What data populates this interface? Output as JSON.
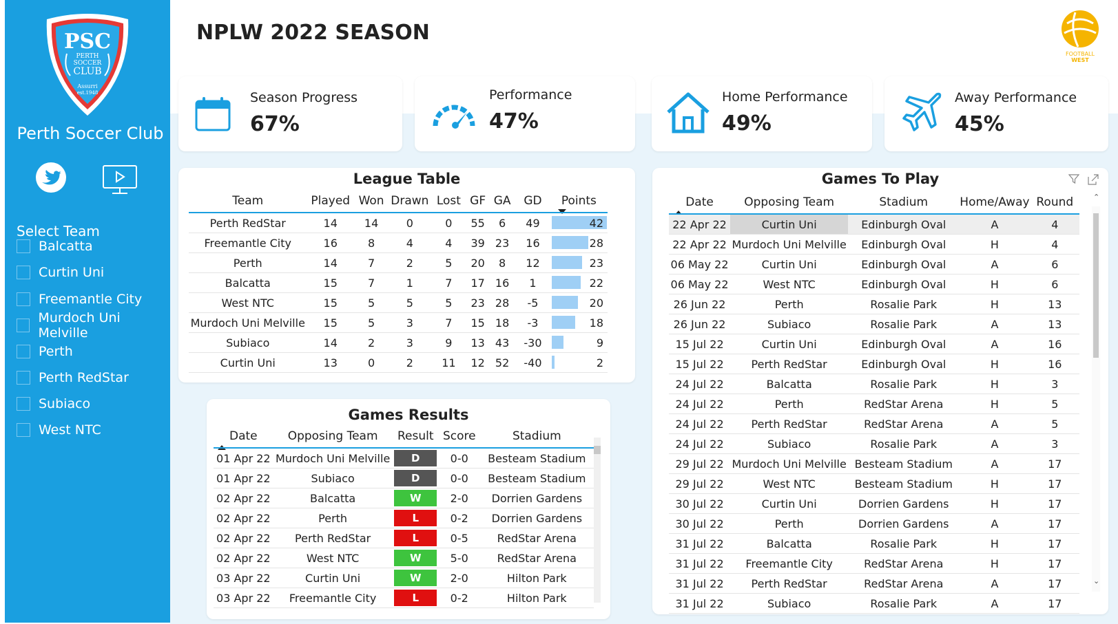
{
  "sidebar": {
    "club_name": "Perth Soccer Club",
    "logo_text": {
      "line1": "PSC",
      "line2": "PERTH",
      "line3": "SOCCER",
      "line4": "CLUB",
      "motto": "Assurri",
      "est": "est.1948"
    },
    "select_label": "Select Team",
    "teams": [
      "Balcatta",
      "Curtin Uni",
      "Freemantle City",
      "Murdoch Uni Melville",
      "Perth",
      "Perth RedStar",
      "Subiaco",
      "West NTC"
    ],
    "icons": [
      "twitter-icon",
      "video-icon"
    ]
  },
  "header": {
    "title": "NPLW 2022 SEASON",
    "partner_logo_text": {
      "line1": "FOOTBALL",
      "line2": "WEST"
    }
  },
  "kpis": [
    {
      "label": "Season Progress",
      "value": "67%",
      "icon": "calendar-icon"
    },
    {
      "label": "Performance",
      "value": "47%",
      "icon": "speedometer-icon"
    },
    {
      "label": "Home Performance",
      "value": "49%",
      "icon": "home-icon"
    },
    {
      "label": "Away Performance",
      "value": "45%",
      "icon": "airplane-icon"
    }
  ],
  "league_table": {
    "title": "League Table",
    "columns": [
      "Team",
      "Played",
      "Won",
      "Drawn",
      "Lost",
      "GF",
      "GA",
      "GD",
      "Points"
    ],
    "max_points": 42,
    "rows": [
      {
        "team": "Perth RedStar",
        "played": "14",
        "won": "14",
        "drawn": "0",
        "lost": "0",
        "gf": "55",
        "ga": "6",
        "gd": "49",
        "points": "42"
      },
      {
        "team": "Freemantle City",
        "played": "16",
        "won": "8",
        "drawn": "4",
        "lost": "4",
        "gf": "39",
        "ga": "23",
        "gd": "16",
        "points": "28"
      },
      {
        "team": "Perth",
        "played": "14",
        "won": "7",
        "drawn": "2",
        "lost": "5",
        "gf": "20",
        "ga": "8",
        "gd": "12",
        "points": "23"
      },
      {
        "team": "Balcatta",
        "played": "15",
        "won": "7",
        "drawn": "1",
        "lost": "7",
        "gf": "17",
        "ga": "16",
        "gd": "1",
        "points": "22"
      },
      {
        "team": "West NTC",
        "played": "15",
        "won": "5",
        "drawn": "5",
        "lost": "5",
        "gf": "23",
        "ga": "28",
        "gd": "-5",
        "points": "20"
      },
      {
        "team": "Murdoch Uni Melville",
        "played": "15",
        "won": "5",
        "drawn": "3",
        "lost": "7",
        "gf": "15",
        "ga": "18",
        "gd": "-3",
        "points": "18"
      },
      {
        "team": "Subiaco",
        "played": "14",
        "won": "2",
        "drawn": "3",
        "lost": "9",
        "gf": "13",
        "ga": "43",
        "gd": "-30",
        "points": "9"
      },
      {
        "team": "Curtin Uni",
        "played": "13",
        "won": "0",
        "drawn": "2",
        "lost": "11",
        "gf": "12",
        "ga": "52",
        "gd": "-40",
        "points": "2"
      }
    ]
  },
  "games_results": {
    "title": "Games Results",
    "columns": [
      "Date",
      "Opposing Team",
      "Result",
      "Score",
      "Stadium"
    ],
    "colors": {
      "D": "#555555",
      "W": "#3ec43e",
      "L": "#e01010"
    },
    "rows": [
      {
        "date": "01 Apr 22",
        "team": "Murdoch Uni Melville",
        "result": "D",
        "score": "0-0",
        "stadium": "Besteam Stadium"
      },
      {
        "date": "01 Apr 22",
        "team": "Subiaco",
        "result": "D",
        "score": "0-0",
        "stadium": "Besteam Stadium"
      },
      {
        "date": "02 Apr 22",
        "team": "Balcatta",
        "result": "W",
        "score": "2-0",
        "stadium": "Dorrien Gardens"
      },
      {
        "date": "02 Apr 22",
        "team": "Perth",
        "result": "L",
        "score": "0-2",
        "stadium": "Dorrien Gardens"
      },
      {
        "date": "02 Apr 22",
        "team": "Perth RedStar",
        "result": "L",
        "score": "0-5",
        "stadium": "RedStar Arena"
      },
      {
        "date": "02 Apr 22",
        "team": "West NTC",
        "result": "W",
        "score": "5-0",
        "stadium": "RedStar Arena"
      },
      {
        "date": "03 Apr 22",
        "team": "Curtin Uni",
        "result": "W",
        "score": "2-0",
        "stadium": "Hilton Park"
      },
      {
        "date": "03 Apr 22",
        "team": "Freemantle City",
        "result": "L",
        "score": "0-2",
        "stadium": "Hilton Park"
      }
    ]
  },
  "games_to_play": {
    "title": "Games To Play",
    "columns": [
      "Date",
      "Opposing Team",
      "Stadium",
      "Home/Away",
      "Round"
    ],
    "rows": [
      {
        "date": "22 Apr 22",
        "team": "Curtin Uni",
        "stadium": "Edinburgh Oval",
        "ha": "A",
        "round": "4"
      },
      {
        "date": "22 Apr 22",
        "team": "Murdoch Uni Melville",
        "stadium": "Edinburgh Oval",
        "ha": "H",
        "round": "4"
      },
      {
        "date": "06 May 22",
        "team": "Curtin Uni",
        "stadium": "Edinburgh Oval",
        "ha": "A",
        "round": "6"
      },
      {
        "date": "06 May 22",
        "team": "West NTC",
        "stadium": "Edinburgh Oval",
        "ha": "H",
        "round": "6"
      },
      {
        "date": "26 Jun 22",
        "team": "Perth",
        "stadium": "Rosalie Park",
        "ha": "H",
        "round": "13"
      },
      {
        "date": "26 Jun 22",
        "team": "Subiaco",
        "stadium": "Rosalie Park",
        "ha": "A",
        "round": "13"
      },
      {
        "date": "15 Jul 22",
        "team": "Curtin Uni",
        "stadium": "Edinburgh Oval",
        "ha": "A",
        "round": "16"
      },
      {
        "date": "15 Jul 22",
        "team": "Perth RedStar",
        "stadium": "Edinburgh Oval",
        "ha": "H",
        "round": "16"
      },
      {
        "date": "24 Jul 22",
        "team": "Balcatta",
        "stadium": "Rosalie Park",
        "ha": "H",
        "round": "3"
      },
      {
        "date": "24 Jul 22",
        "team": "Perth",
        "stadium": "RedStar Arena",
        "ha": "H",
        "round": "5"
      },
      {
        "date": "24 Jul 22",
        "team": "Perth RedStar",
        "stadium": "RedStar Arena",
        "ha": "A",
        "round": "5"
      },
      {
        "date": "24 Jul 22",
        "team": "Subiaco",
        "stadium": "Rosalie Park",
        "ha": "A",
        "round": "3"
      },
      {
        "date": "29 Jul 22",
        "team": "Murdoch Uni Melville",
        "stadium": "Besteam Stadium",
        "ha": "A",
        "round": "17"
      },
      {
        "date": "29 Jul 22",
        "team": "West NTC",
        "stadium": "Besteam Stadium",
        "ha": "H",
        "round": "17"
      },
      {
        "date": "30 Jul 22",
        "team": "Curtin Uni",
        "stadium": "Dorrien Gardens",
        "ha": "H",
        "round": "17"
      },
      {
        "date": "30 Jul 22",
        "team": "Perth",
        "stadium": "Dorrien Gardens",
        "ha": "A",
        "round": "17"
      },
      {
        "date": "31 Jul 22",
        "team": "Balcatta",
        "stadium": "Rosalie Park",
        "ha": "H",
        "round": "17"
      },
      {
        "date": "31 Jul 22",
        "team": "Freemantle City",
        "stadium": "RedStar Arena",
        "ha": "H",
        "round": "17"
      },
      {
        "date": "31 Jul 22",
        "team": "Perth RedStar",
        "stadium": "RedStar Arena",
        "ha": "A",
        "round": "17"
      },
      {
        "date": "31 Jul 22",
        "team": "Subiaco",
        "stadium": "Rosalie Park",
        "ha": "A",
        "round": "17"
      }
    ]
  },
  "colors": {
    "accent": "#1a9fe0",
    "bar": "#9fcff5",
    "background_band": "#e9f4fb",
    "logo_gold": "#f5b400"
  }
}
